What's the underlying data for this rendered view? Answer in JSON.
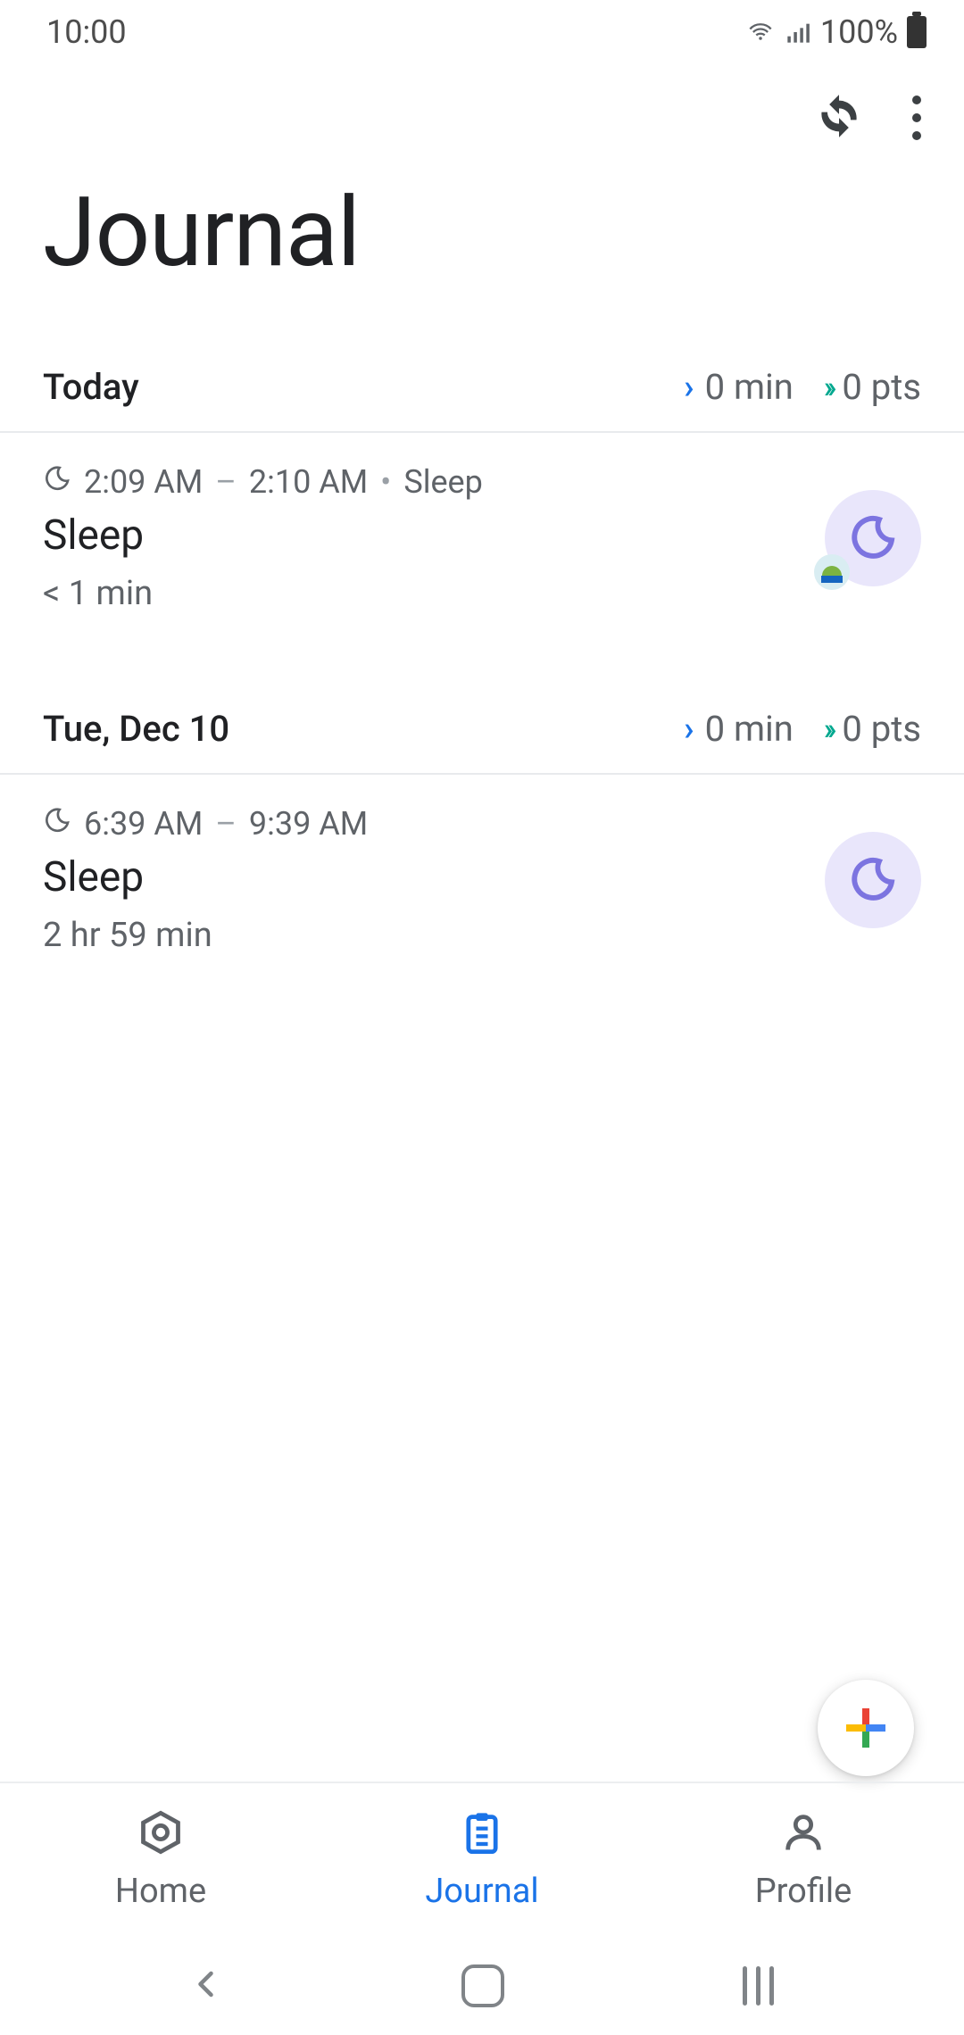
{
  "status": {
    "time": "10:00",
    "battery": "100%"
  },
  "header": {
    "title": "Journal"
  },
  "days": [
    {
      "label": "Today",
      "stats": {
        "minutes": "0 min",
        "points": "0 pts"
      },
      "entries": [
        {
          "timerange": {
            "start": "2:09 AM",
            "end": "2:10 AM",
            "type": "Sleep"
          },
          "title": "Sleep",
          "duration": "< 1 min",
          "has_source_badge": true
        }
      ]
    },
    {
      "label": "Tue, Dec 10",
      "stats": {
        "minutes": "0 min",
        "points": "0 pts"
      },
      "entries": [
        {
          "timerange": {
            "start": "6:39 AM",
            "end": "9:39 AM"
          },
          "title": "Sleep",
          "duration": "2 hr 59 min",
          "has_source_badge": false
        }
      ]
    }
  ],
  "nav": {
    "home": "Home",
    "journal": "Journal",
    "profile": "Profile"
  }
}
